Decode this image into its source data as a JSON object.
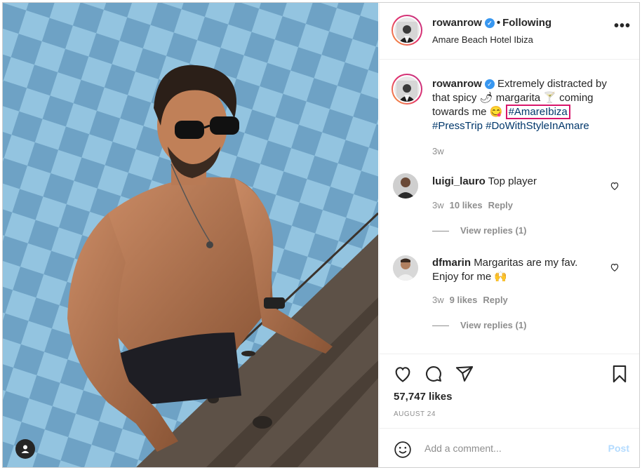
{
  "post": {
    "username": "rowanrow",
    "follow_status": "Following",
    "location": "Amare Beach Hotel Ibiza",
    "more_icon": "more-options-icon"
  },
  "caption": {
    "username": "rowanrow",
    "text_1": "Extremely distracted by that spicy",
    "text_2": "margarita",
    "text_3": "coming towards me",
    "emoji_1": "🌶",
    "emoji_2": "🍸",
    "emoji_3": "😋",
    "hashtag_highlight": "#AmareIbiza",
    "hashtags": "#PressTrip #DoWithStyleInAmare",
    "age": "3w"
  },
  "comments": [
    {
      "username": "luigi_lauro",
      "text": "Top player",
      "age": "3w",
      "likes": "10 likes",
      "reply": "Reply",
      "view_replies": "View replies (1)"
    },
    {
      "username": "dfmarin",
      "text": "Margaritas are my fav. Enjoy for me",
      "emoji": "🙌",
      "age": "3w",
      "likes": "9 likes",
      "reply": "Reply",
      "view_replies": "View replies (1)"
    }
  ],
  "actions": {
    "likes": "57,747 likes",
    "date": "AUGUST 24"
  },
  "add_comment": {
    "placeholder": "Add a comment...",
    "post_label": "Post"
  },
  "colors": {
    "highlight_box": "#d8156b",
    "hashtag": "#00376b",
    "verified": "#3897f0",
    "post_button_disabled": "#b3dbff"
  }
}
